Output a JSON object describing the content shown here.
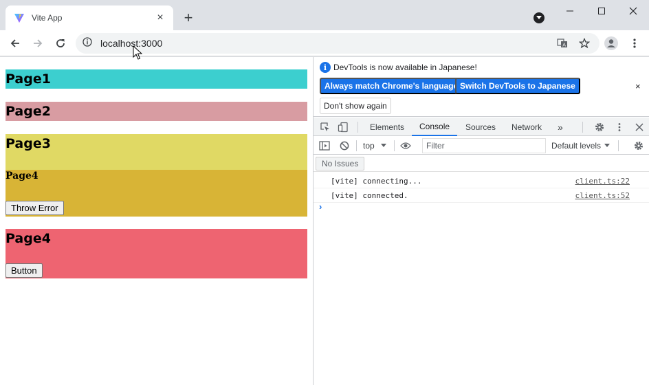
{
  "browser": {
    "tab_title": "Vite App",
    "tab_close": "×",
    "new_tab": "+",
    "url": "localhost:3000",
    "icons": [
      "vite-logo-icon",
      "close-icon",
      "plus-icon",
      "minimize-icon",
      "maximize-icon",
      "window-close-icon",
      "back-arrow-icon",
      "forward-arrow-icon",
      "reload-icon",
      "info-circle-icon",
      "translate-icon",
      "star-icon",
      "profile-icon",
      "kebab-menu-icon"
    ]
  },
  "page": {
    "page1_title": "Page1",
    "page2_title": "Page2",
    "page3_title": "Page3",
    "page4_inner_title": "Page4",
    "throw_error_label": "Throw Error",
    "page4_title": "Page4",
    "button_label": "Button",
    "colors": {
      "page1": "#3ccfcf",
      "page2": "#d89ca2",
      "page3": "#e0d964",
      "page4_inner": "#d8b436",
      "page4": "#ee6471"
    }
  },
  "devtools": {
    "info_message": "DevTools is now available in Japanese!",
    "match_language_label": "Always match Chrome's language",
    "switch_language_label": "Switch DevTools to Japanese",
    "dont_show_label": "Don't show again",
    "close_label": "×",
    "tabs": [
      {
        "label": "Elements",
        "active": false
      },
      {
        "label": "Console",
        "active": true
      },
      {
        "label": "Sources",
        "active": false
      },
      {
        "label": "Network",
        "active": false
      }
    ],
    "more_tabs": "»",
    "context": "top",
    "filter_placeholder": "Filter",
    "levels": "Default levels",
    "issues_label": "No Issues",
    "logs": [
      {
        "message": "[vite] connecting...",
        "source": "client.ts:22"
      },
      {
        "message": "[vite] connected.",
        "source": "client.ts:52"
      }
    ],
    "prompt": "›",
    "accent": "#1a73e8"
  }
}
